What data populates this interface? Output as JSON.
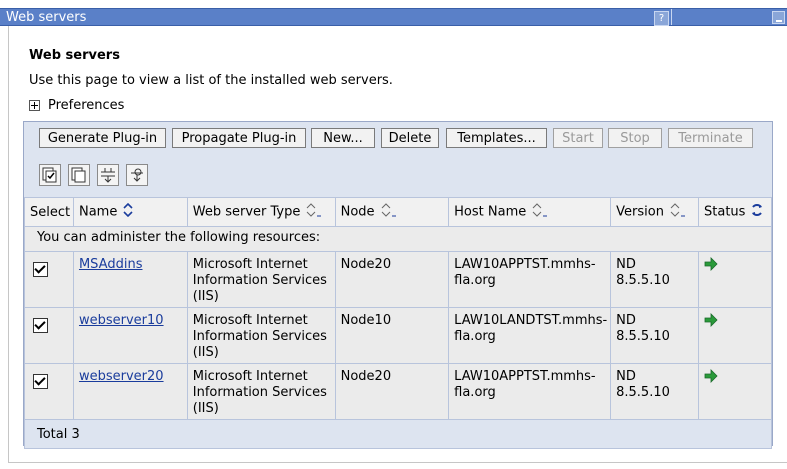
{
  "window": {
    "title": "Web servers",
    "help_label": "?"
  },
  "page": {
    "heading": "Web servers",
    "description": "Use this page to view a list of the installed web servers.",
    "preferences_label": "Preferences"
  },
  "toolbar": {
    "generate_label": "Generate Plug-in",
    "propagate_label": "Propagate Plug-in",
    "new_label": "New...",
    "delete_label": "Delete",
    "templates_label": "Templates...",
    "start_label": "Start",
    "stop_label": "Stop",
    "terminate_label": "Terminate"
  },
  "table": {
    "headers": {
      "select": "Select",
      "name": "Name",
      "type": "Web server Type",
      "node": "Node",
      "host": "Host Name",
      "version": "Version",
      "status": "Status"
    },
    "info": "You can administer the following resources:",
    "rows": [
      {
        "name": "MSAddins",
        "type1": "Microsoft Internet",
        "type2": "Information Services",
        "type3": "(IIS)",
        "node": "Node20",
        "host1": "LAW10APPTST.mmhs-",
        "host2": "fla.org",
        "ver1": "ND",
        "ver2": "8.5.5.10",
        "status": "running"
      },
      {
        "name": "webserver10",
        "type1": "Microsoft Internet",
        "type2": "Information Services",
        "type3": "(IIS)",
        "node": "Node10",
        "host1": "LAW10LANDTST.mmhs-",
        "host2": "fla.org",
        "ver1": "ND",
        "ver2": "8.5.5.10",
        "status": "running"
      },
      {
        "name": "webserver20",
        "type1": "Microsoft Internet",
        "type2": "Information Services",
        "type3": "(IIS)",
        "node": "Node20",
        "host1": "LAW10APPTST.mmhs-",
        "host2": "fla.org",
        "ver1": "ND",
        "ver2": "8.5.5.10",
        "status": "running"
      }
    ],
    "total": "Total 3"
  },
  "colors": {
    "titlebar": "#5a80c8",
    "link": "#1a3c9c",
    "status_arrow": "#2a9a3a"
  }
}
